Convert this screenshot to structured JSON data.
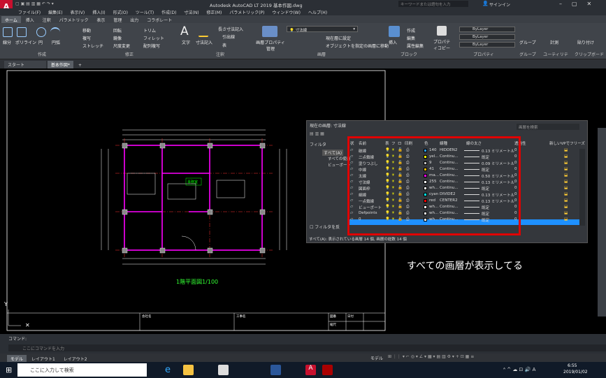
{
  "title": "Autodesk AutoCAD LT 2019    基本作図.dwg",
  "search_placeholder": "キーワードまたは語句を入力",
  "user": "サインイン",
  "menu": [
    "ファイル(F)",
    "編集(E)",
    "表示(V)",
    "挿入(I)",
    "形式(O)",
    "ツール(T)",
    "作成(D)",
    "寸法(N)",
    "修正(M)",
    "パラメトリック(P)",
    "ウィンドウ(W)",
    "ヘルプ(H)"
  ],
  "ribbon_tabs": [
    "ホーム",
    "挿入",
    "注釈",
    "パラメトリック",
    "表示",
    "管理",
    "出力",
    "コラボレート"
  ],
  "ribbon": {
    "draw_buttons": [
      "線分",
      "ポリライン",
      "円",
      "円弧"
    ],
    "modify_buttons": [
      "移動",
      "回転",
      "トリム",
      "複写",
      "鏡像",
      "フィレット",
      "ストレッチ",
      "尺度変更",
      "配列複写"
    ],
    "annot_buttons": [
      "文字",
      "寸法記入",
      "引出線",
      "表"
    ],
    "annot_linear": "長さ寸法記入",
    "layer_prop": "画層プロパティ管理",
    "layer_current": "寸法線",
    "layer_actions": [
      "現在層に設定",
      "オブジェクトを指定の画層に移動"
    ],
    "block_buttons": [
      "挿入",
      "作成",
      "編集",
      "属性編集"
    ],
    "prop_copy": "プロパティコピー",
    "bylayer": "ByLayer",
    "group": "グループ",
    "utility": "計測",
    "paste": "貼り付け",
    "groups": [
      "作成",
      "修正",
      "注釈",
      "画層",
      "ブロック",
      "プロパティ",
      "グループ",
      "ユーティリティ",
      "クリップボード"
    ]
  },
  "doc_tabs": [
    "スタート",
    "基本作図*"
  ],
  "drawing": {
    "plan_title": "1階平面図1/100",
    "room_label": "事務室",
    "titleblock": [
      "会社名",
      "工事名",
      "図番",
      "日付",
      "縮尺"
    ]
  },
  "layer_panel": {
    "header": "現在の画層: 寸法線",
    "search": "画層を検索",
    "filter_label": "フィルタ",
    "filter_all": "すべて(A)",
    "filter_used": "すべての使用",
    "filter_vp": "ビューポート",
    "invert": "フィルタを反",
    "columns": [
      "状",
      "名前",
      "表",
      "フ",
      "ロ",
      "印刷",
      "色",
      "線種",
      "線の太さ",
      "透過性",
      "新しいVPでフリーズ"
    ],
    "layers": [
      {
        "name": "破線",
        "color": "140",
        "hex": "#2aa0ff",
        "linetype": "HIDDEN2",
        "weight": "0.13 ミリメートル",
        "trans": "0"
      },
      {
        "name": "二点鎖線",
        "color": "yel...",
        "hex": "#ffff00",
        "linetype": "Continu...",
        "weight": "既定",
        "trans": "0"
      },
      {
        "name": "塗りつぶし",
        "color": "9",
        "hex": "#c0c0c0",
        "linetype": "Continu...",
        "weight": "0.09 ミリメートル",
        "trans": "0"
      },
      {
        "name": "中線",
        "color": "41",
        "hex": "#ffbf00",
        "linetype": "Continu...",
        "weight": "既定",
        "trans": "0"
      },
      {
        "name": "太線",
        "color": "ma...",
        "hex": "#ff00ff",
        "linetype": "Continu...",
        "weight": "0.50 ミリメートル",
        "trans": "0"
      },
      {
        "name": "寸法線",
        "color": "255",
        "hex": "#ffffff",
        "linetype": "Continu...",
        "weight": "0.13 ミリメートル",
        "trans": "0"
      },
      {
        "name": "図面枠",
        "color": "wh...",
        "hex": "#ffffff",
        "linetype": "Continu...",
        "weight": "既定",
        "trans": "0"
      },
      {
        "name": "細線",
        "color": "cyan",
        "hex": "#00ffff",
        "linetype": "DIVIDE2",
        "weight": "0.13 ミリメートル",
        "trans": "0"
      },
      {
        "name": "一点鎖線",
        "color": "red",
        "hex": "#ff0000",
        "linetype": "CENTER2",
        "weight": "0.13 ミリメートル",
        "trans": "0"
      },
      {
        "name": "ビューポート",
        "color": "wh...",
        "hex": "#ffffff",
        "linetype": "Continu...",
        "weight": "既定",
        "trans": "0"
      },
      {
        "name": "Defpoints",
        "color": "wh...",
        "hex": "#ffffff",
        "linetype": "Continu...",
        "weight": "既定",
        "trans": "0"
      },
      {
        "name": "0",
        "color": "wh...",
        "hex": "#ffffff",
        "linetype": "Continu...",
        "weight": "既定",
        "trans": "0"
      }
    ],
    "footer": "すべて(A): 表示されている画層 14 個, 画層の総数 14 個"
  },
  "annotation": "すべての画層が表示してる",
  "command": {
    "label": "コマンド:",
    "placeholder": "ここにコマンドを入力"
  },
  "layout_tabs": [
    "モデル",
    "レイアウト1",
    "レイアウト2"
  ],
  "status_model": "モデル",
  "taskbar": {
    "search": "ここに入力して検索",
    "time": "6:55",
    "date": "2019/01/02"
  }
}
